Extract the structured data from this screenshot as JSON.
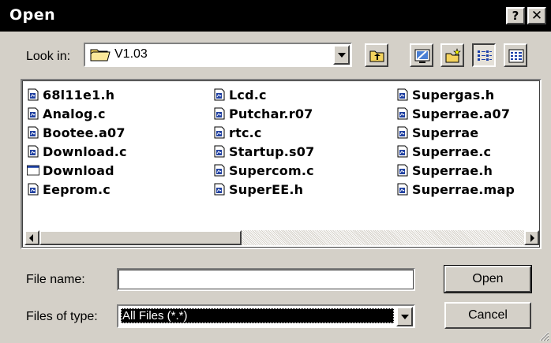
{
  "window": {
    "title": "Open",
    "help_label": "?",
    "close_label": "✕"
  },
  "look_in": {
    "label": "Look in:",
    "value": "V1.03",
    "icon": "folder-icon"
  },
  "toolbar": {
    "up_icon": "up-one-level-icon",
    "desktop_icon": "desktop-icon",
    "new_folder_icon": "new-folder-icon",
    "list_view_icon": "list-view-icon",
    "details_view_icon": "details-view-icon"
  },
  "files": {
    "col1": [
      {
        "name": "68l11e1.h",
        "icon": "document-icon"
      },
      {
        "name": "Analog.c",
        "icon": "document-icon"
      },
      {
        "name": "Bootee.a07",
        "icon": "document-icon"
      },
      {
        "name": "Download.c",
        "icon": "document-icon"
      },
      {
        "name": "Download",
        "icon": "application-window-icon"
      },
      {
        "name": "Eeprom.c",
        "icon": "document-icon"
      }
    ],
    "col2": [
      {
        "name": "Lcd.c",
        "icon": "document-icon"
      },
      {
        "name": "Putchar.r07",
        "icon": "document-icon"
      },
      {
        "name": "rtc.c",
        "icon": "document-icon"
      },
      {
        "name": "Startup.s07",
        "icon": "document-icon"
      },
      {
        "name": "Supercom.c",
        "icon": "document-icon"
      },
      {
        "name": "SuperEE.h",
        "icon": "document-icon"
      }
    ],
    "col3": [
      {
        "name": "Supergas.h",
        "icon": "document-icon"
      },
      {
        "name": "Superrae.a07",
        "icon": "document-icon"
      },
      {
        "name": "Superrae",
        "icon": "document-icon"
      },
      {
        "name": "Superrae.c",
        "icon": "document-icon"
      },
      {
        "name": "Superrae.h",
        "icon": "document-icon"
      },
      {
        "name": "Superrae.map",
        "icon": "document-icon"
      }
    ]
  },
  "file_name": {
    "label": "File name:",
    "value": ""
  },
  "file_type": {
    "label": "Files of type:",
    "value": "All Files (*.*)"
  },
  "buttons": {
    "open": "Open",
    "cancel": "Cancel"
  },
  "colors": {
    "face": "#d4d0c8",
    "titlebar": "#000000",
    "folder": "#f4d35e",
    "selection": "#000000"
  }
}
